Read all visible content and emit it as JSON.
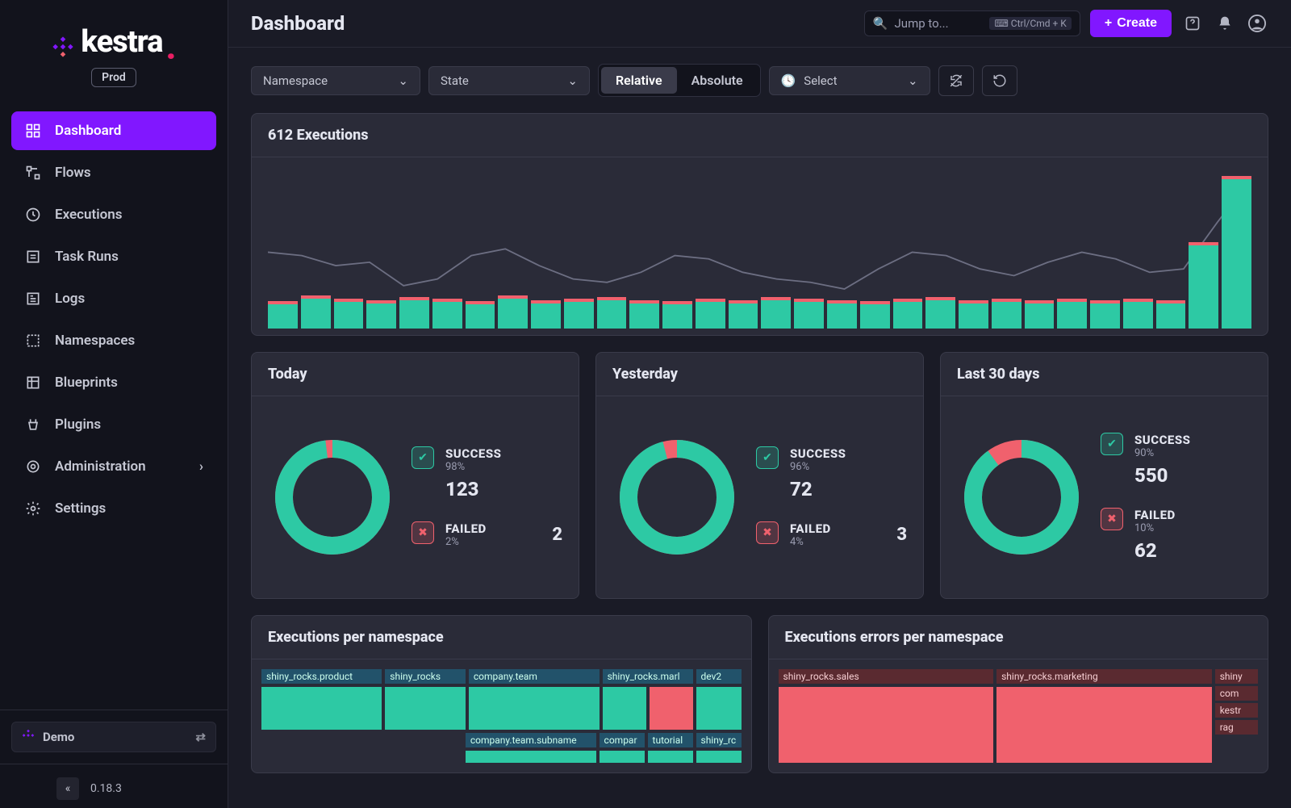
{
  "brand": {
    "name": "kestra",
    "env_badge": "Prod"
  },
  "sidebar": {
    "items": [
      {
        "label": "Dashboard",
        "icon": "grid-icon",
        "active": true
      },
      {
        "label": "Flows",
        "icon": "flow-icon"
      },
      {
        "label": "Executions",
        "icon": "clock-play-icon"
      },
      {
        "label": "Task Runs",
        "icon": "task-run-icon"
      },
      {
        "label": "Logs",
        "icon": "logs-icon"
      },
      {
        "label": "Namespaces",
        "icon": "namespace-icon"
      },
      {
        "label": "Blueprints",
        "icon": "blueprint-icon"
      },
      {
        "label": "Plugins",
        "icon": "plugin-icon"
      },
      {
        "label": "Administration",
        "icon": "admin-icon",
        "chevron": true
      },
      {
        "label": "Settings",
        "icon": "gear-icon"
      }
    ],
    "context": {
      "label": "Demo"
    },
    "version": "0.18.3"
  },
  "topbar": {
    "title": "Dashboard",
    "search_placeholder": "Jump to...",
    "search_kbd": "Ctrl/Cmd + K",
    "create_label": "Create"
  },
  "filters": {
    "namespace_label": "Namespace",
    "state_label": "State",
    "relative_label": "Relative",
    "absolute_label": "Absolute",
    "select_label": "Select"
  },
  "executions_card": {
    "title": "612 Executions"
  },
  "chart_data": {
    "type": "bar",
    "title": "612 Executions",
    "bars": [
      {
        "s": 16,
        "f": 3
      },
      {
        "s": 20,
        "f": 3
      },
      {
        "s": 18,
        "f": 3
      },
      {
        "s": 17,
        "f": 3
      },
      {
        "s": 19,
        "f": 3
      },
      {
        "s": 18,
        "f": 3
      },
      {
        "s": 16,
        "f": 3
      },
      {
        "s": 20,
        "f": 3
      },
      {
        "s": 17,
        "f": 3
      },
      {
        "s": 18,
        "f": 3
      },
      {
        "s": 19,
        "f": 3
      },
      {
        "s": 17,
        "f": 3
      },
      {
        "s": 16,
        "f": 3
      },
      {
        "s": 18,
        "f": 3
      },
      {
        "s": 17,
        "f": 3
      },
      {
        "s": 19,
        "f": 3
      },
      {
        "s": 18,
        "f": 3
      },
      {
        "s": 17,
        "f": 3
      },
      {
        "s": 16,
        "f": 3
      },
      {
        "s": 18,
        "f": 3
      },
      {
        "s": 19,
        "f": 3
      },
      {
        "s": 17,
        "f": 3
      },
      {
        "s": 18,
        "f": 3
      },
      {
        "s": 17,
        "f": 3
      },
      {
        "s": 18,
        "f": 3
      },
      {
        "s": 17,
        "f": 3
      },
      {
        "s": 18,
        "f": 3
      },
      {
        "s": 17,
        "f": 3
      },
      {
        "s": 56,
        "f": 4
      },
      {
        "s": 100,
        "f": 5
      }
    ],
    "line": [
      52,
      50,
      44,
      46,
      32,
      36,
      50,
      54,
      44,
      36,
      34,
      40,
      50,
      48,
      40,
      36,
      34,
      30,
      42,
      52,
      50,
      42,
      38,
      46,
      52,
      48,
      40,
      42,
      70,
      96
    ]
  },
  "periods": [
    {
      "title": "Today",
      "success_pct": "98%",
      "success_cnt": "123",
      "failed_pct": "2%",
      "failed_cnt": "2",
      "donut_success": 98
    },
    {
      "title": "Yesterday",
      "success_pct": "96%",
      "success_cnt": "72",
      "failed_pct": "4%",
      "failed_cnt": "3",
      "donut_success": 96
    },
    {
      "title": "Last 30 days",
      "success_pct": "90%",
      "success_cnt": "550",
      "failed_pct": "10%",
      "failed_cnt": "62",
      "donut_success": 90
    }
  ],
  "labels": {
    "success": "SUCCESS",
    "failed": "FAILED"
  },
  "ns_cards": {
    "exec_title": "Executions per namespace",
    "err_title": "Executions errors per namespace",
    "exec_tree": {
      "row1": [
        "shiny_rocks.product",
        "shiny_rocks",
        "company.team",
        "shiny_rocks.marl",
        "dev2"
      ],
      "row2": [
        "company.team.subname",
        "compar",
        "tutorial",
        "shiny_rc"
      ]
    },
    "err_tree": {
      "cols": [
        "shiny_rocks.sales",
        "shiny_rocks.marketing"
      ],
      "side": [
        "shiny",
        "com",
        "kestr",
        "rag"
      ]
    }
  }
}
